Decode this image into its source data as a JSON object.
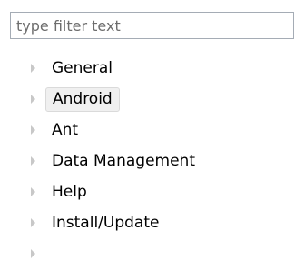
{
  "filter": {
    "placeholder": "type filter text",
    "value": ""
  },
  "tree": {
    "items": [
      {
        "label": "General",
        "icon": "triangle-right-icon"
      },
      {
        "label": "Android",
        "icon": "triangle-right-icon",
        "highlighted": true
      },
      {
        "label": "Ant",
        "icon": "triangle-right-icon"
      },
      {
        "label": "Data Management",
        "icon": "triangle-right-icon"
      },
      {
        "label": "Help",
        "icon": "triangle-right-icon"
      },
      {
        "label": "Install/Update",
        "icon": "triangle-right-icon"
      },
      {
        "label": "",
        "icon": "triangle-right-icon"
      }
    ]
  },
  "colors": {
    "hover_background": "#f0f0f0",
    "expander": "#c8c8c8",
    "border": "#a5acb5"
  }
}
